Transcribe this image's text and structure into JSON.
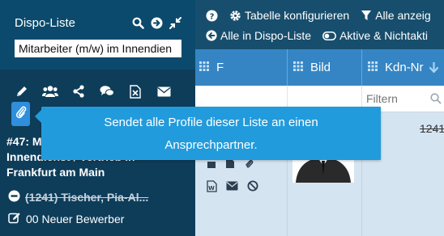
{
  "sidebar": {
    "title": "Dispo-Liste",
    "search_value": "Mitarbeiter (m/w) im Innendien",
    "record_lines": [
      "#47: Mitarbeiter (m/w) im",
      "Innendienst / Vertrieb in",
      "Frankfurt am Main"
    ],
    "entry": "(1241) Tischer, Pia-Al...",
    "new_applicant": "00 Neuer Bewerber"
  },
  "toolbar": {
    "configure_table": "Tabelle konfigurieren",
    "show_all": "Alle anzeig",
    "all_in_dispo": "Alle in Dispo-Liste",
    "active_inactive": "Aktive & Nichtakti"
  },
  "grid": {
    "columns": [
      "F",
      "Bild",
      "Kdn-Nr"
    ],
    "filter_placeholder": "Filtern",
    "row_number": "1241"
  },
  "tooltip": {
    "line1": "Sendet alle Profile dieser Liste an einen",
    "line2": "Ansprechpartner."
  },
  "colors": {
    "sidebar_bg": "#0b4a6c",
    "toolbar_bg": "#184e6d",
    "grid_header_bg": "#3585c4",
    "tooltip_bg": "#229bdc",
    "active_button_bg": "#2f8fdb"
  }
}
